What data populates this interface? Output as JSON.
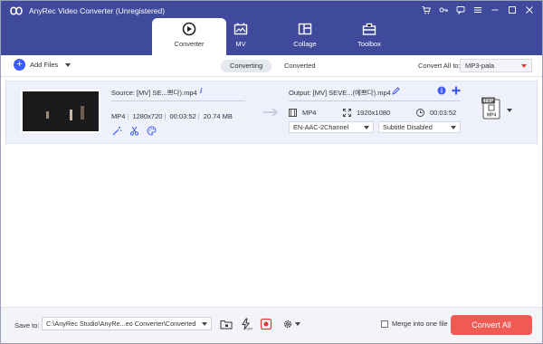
{
  "window": {
    "title": "AnyRec Video Converter (Unregistered)",
    "controls": [
      "cart-icon",
      "key-icon",
      "chat-icon",
      "menu-icon",
      "minimize-icon",
      "maximize-icon",
      "close-icon"
    ]
  },
  "tabs": [
    {
      "label": "Converter",
      "icon": "converter-icon",
      "active": true
    },
    {
      "label": "MV",
      "icon": "mv-icon",
      "active": false
    },
    {
      "label": "Collage",
      "icon": "collage-icon",
      "active": false
    },
    {
      "label": "Toolbox",
      "icon": "toolbox-icon",
      "active": false
    }
  ],
  "toolbar": {
    "add_files_label": "Add Files",
    "segments": [
      "Converting",
      "Converted"
    ],
    "convert_all_label": "Convert All to:",
    "convert_all_value": "MP3-pala"
  },
  "file": {
    "source": "Source: [MV] SE...쁘다).mp4",
    "format": "MP4",
    "resolution": "1280x720",
    "duration": "00:03:52",
    "size": "20.74 MB",
    "output": "Output: [MV] SEVE...(예쁘다).mp4",
    "out_format": "MP4",
    "out_resolution": "1920x1080",
    "out_duration": "00:03:52",
    "audio_track": "EN-AAC-2Channel",
    "subtitle": "Subtitle Disabled",
    "format_badge_top": "480P",
    "format_badge_bottom": "MP4"
  },
  "bottom": {
    "save_to_label": "Save to:",
    "save_path": "C:\\AnyRec Studio\\AnyRe...eo Converter\\Converted",
    "merge_label": "Merge into one file",
    "convert_all_button": "Convert All"
  },
  "colors": {
    "header_bg": "#3f4a9c",
    "accent_blue": "#3d5afe",
    "convert_button": "#f05a55",
    "file_row_bg": "#eef0fc"
  }
}
